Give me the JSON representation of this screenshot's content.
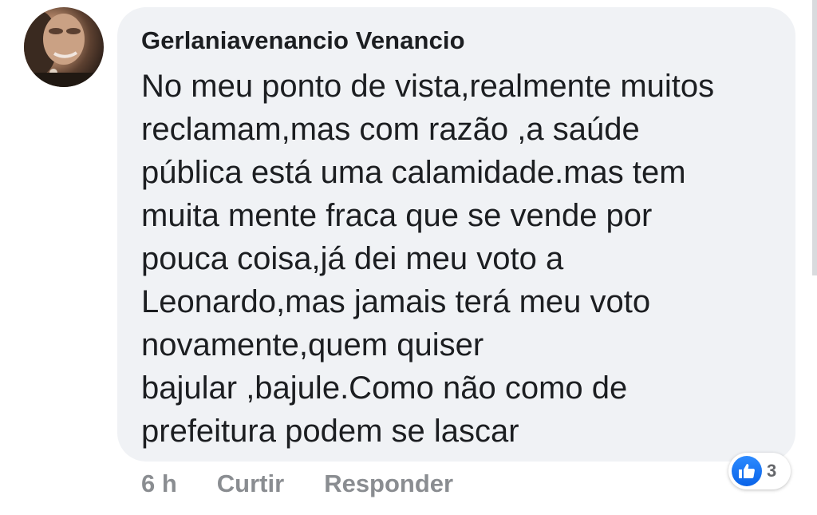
{
  "comment": {
    "author": "Gerlaniavenancio Venancio",
    "lines": [
      "No meu ponto de vista,realmente muitos",
      "reclamam,mas com razão ,a saúde",
      "pública está uma calamidade.mas tem",
      "muita mente fraca que se vende por",
      "pouca coisa,já dei meu voto a",
      "Leonardo,mas jamais terá meu voto",
      "novamente,quem quiser",
      "bajular ,bajule.Como não como de",
      "prefeitura podem se lascar"
    ],
    "time": "6 h",
    "like_label": "Curtir",
    "reply_label": "Responder",
    "reaction_icon": "like-icon",
    "reaction_count": "3"
  },
  "colors": {
    "bubble_bg": "#f0f2f5",
    "text": "#1c1e21",
    "muted": "#8a8d91",
    "like_blue": "#1877f2"
  }
}
